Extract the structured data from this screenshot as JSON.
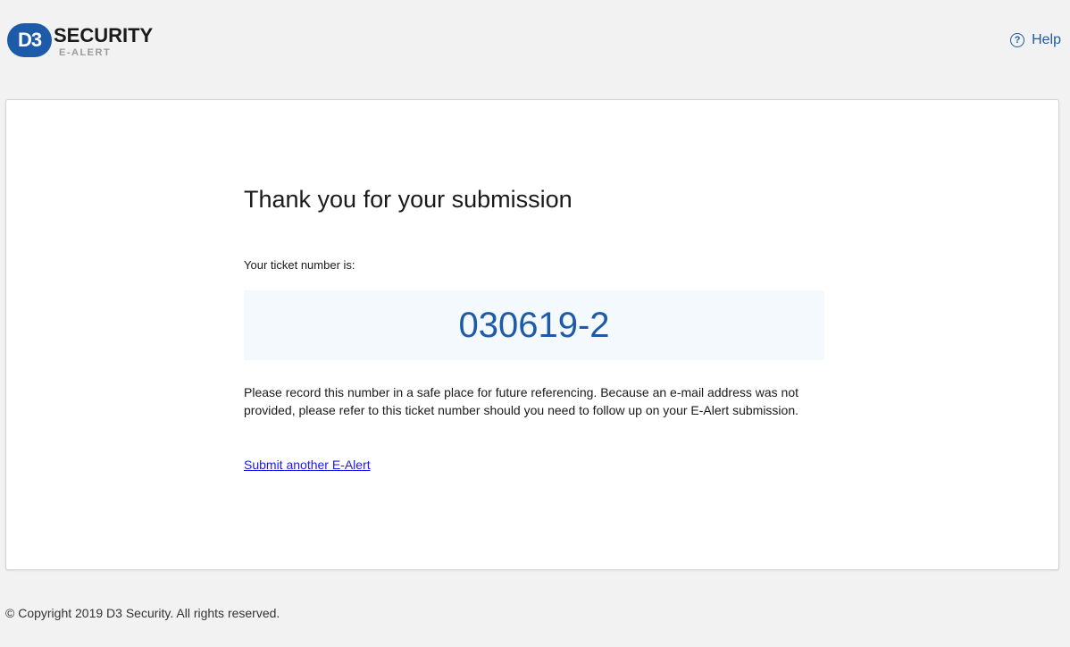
{
  "header": {
    "logo_mark": "D3",
    "logo_brand": "SECURITY",
    "logo_product": "E-ALERT",
    "help_label": "Help",
    "help_icon": "?"
  },
  "confirmation": {
    "title": "Thank you for your submission",
    "ticket_label": "Your ticket number is:",
    "ticket_number": "030619-2",
    "note": "Please record this number in a safe place for future referencing. Because an e-mail address was not provided, please refer to this ticket number should you need to follow up on your E-Alert submission.",
    "submit_another_link": "Submit another E-Alert"
  },
  "footer": {
    "copyright": "© Copyright 2019 D3 Security. All rights reserved."
  },
  "colors": {
    "brand_blue": "#1d5ba8",
    "link_blue": "#1a1aee",
    "ticket_box_bg": "#f3f9fd",
    "page_bg": "#f2f2f2"
  }
}
